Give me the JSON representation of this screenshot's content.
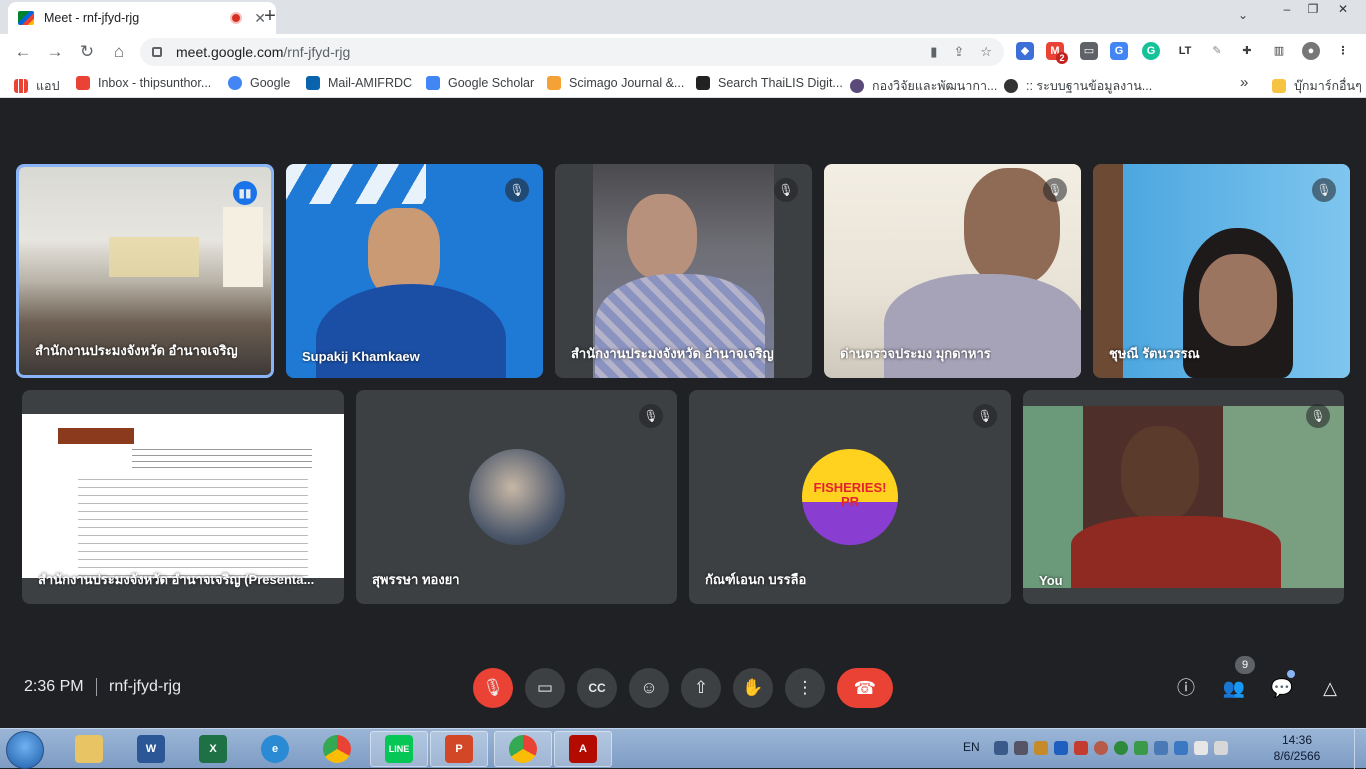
{
  "browser": {
    "tab_title": "Meet - rnf-jfyd-rjg",
    "tab_close": "✕",
    "new_tab": "+",
    "url_host": "meet.google.com",
    "url_path": "/rnf-jfyd-rjg",
    "ext_badge": "2"
  },
  "bookmarks": {
    "apps": "แอป",
    "items": [
      {
        "label": "Inbox - thipsunthor...",
        "icon": "gmail-icon",
        "color": "#ea4335"
      },
      {
        "label": "Google",
        "icon": "google-icon",
        "color": "#4285f4"
      },
      {
        "label": "Mail-AMIFRDC",
        "icon": "outlook-icon",
        "color": "#0a64ad"
      },
      {
        "label": "Google Scholar",
        "icon": "scholar-icon",
        "color": "#4285f4"
      },
      {
        "label": "Scimago Journal &...",
        "icon": "sjr-icon",
        "color": "#f4a236"
      },
      {
        "label": "Search ThaiLIS Digit...",
        "icon": "penguin-icon",
        "color": "#222222"
      },
      {
        "label": "กองวิจัยและพัฒนากา...",
        "icon": "dept-icon",
        "color": "#5a4a7a"
      },
      {
        "label": ":: ระบบฐานข้อมูลงาน...",
        "icon": "globe-icon",
        "color": "#333333"
      }
    ],
    "overflow": "»",
    "other": "บุ๊กมาร์กอื่นๆ"
  },
  "participants": [
    {
      "name": "สำนักงานประมงจังหวัด อำนาจเจริญ",
      "speaking": true
    },
    {
      "name": "Supakij Khamkaew",
      "muted": true
    },
    {
      "name": "สำนักงานประมงจังหวัด อำนาจเจริญ",
      "muted": true
    },
    {
      "name": "ด่านตรวจประมง มุกดาหาร",
      "muted": true
    },
    {
      "name": "ชุษณี รัตนวรรณ",
      "muted": true
    },
    {
      "name": "สำนักงานประมงจังหวัด อำนาจเจริญ (Presenta...",
      "presenting": true
    },
    {
      "name": "สุพรรษา ทองยา",
      "muted": true
    },
    {
      "name": "กัณฑ์เอนก บรรลือ",
      "muted": true,
      "avatar_text": "FISHERIES! PR"
    },
    {
      "name": "You",
      "muted": true
    }
  ],
  "meeting": {
    "time": "2:36 PM",
    "code": "rnf-jfyd-rjg",
    "participant_count": "9"
  },
  "taskbar": {
    "lang": "EN",
    "time": "14:36",
    "date": "8/6/2566"
  },
  "colors": {
    "meet_bg": "#202124",
    "tile_bg": "#3c4043",
    "end_call": "#ea4335",
    "speaking_border": "#8ab4f8"
  }
}
